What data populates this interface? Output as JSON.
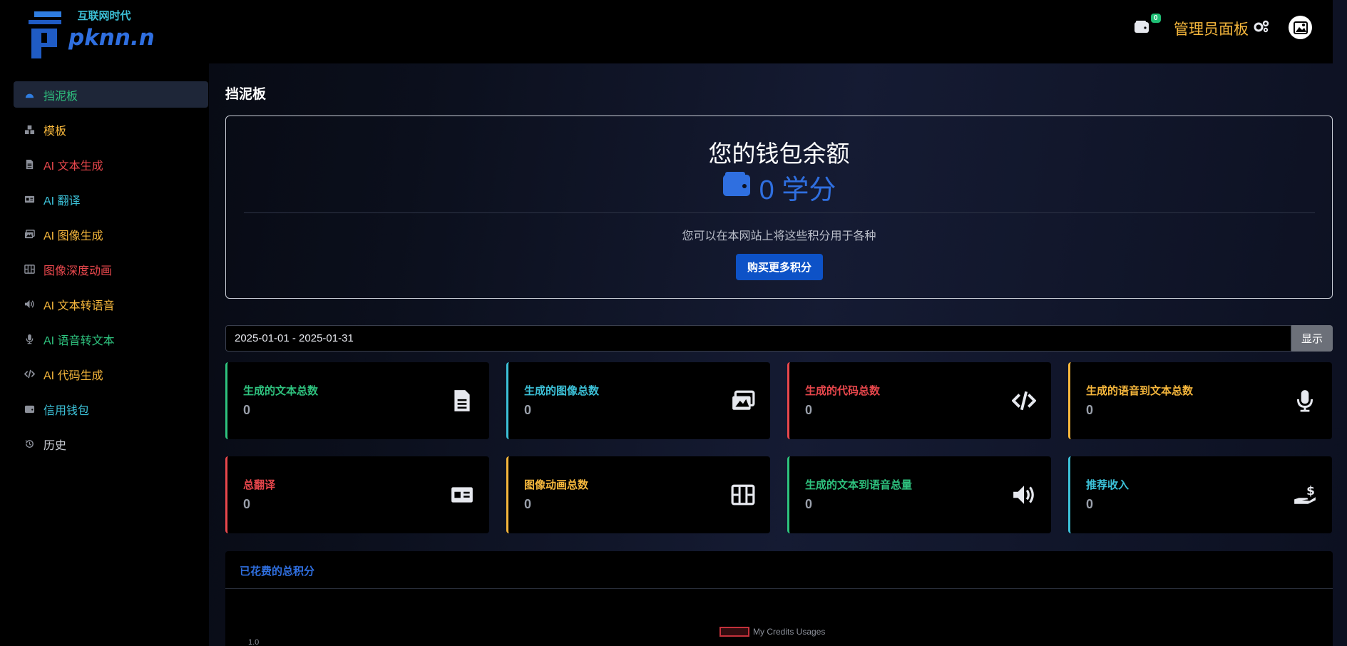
{
  "logo": {
    "brand": "pknn.net",
    "tagline": "互联网时代"
  },
  "topbar": {
    "wallet_count": "0",
    "admin_label": "管理员面板"
  },
  "sidebar": {
    "items": [
      {
        "label": "挡泥板",
        "icon": "dashboard-icon",
        "color": "#2ec27e",
        "active": true
      },
      {
        "label": "模板",
        "icon": "templates-icon",
        "color": "#f6b73c"
      },
      {
        "label": "AI 文本生成",
        "icon": "document-icon",
        "color": "#e8474c"
      },
      {
        "label": "AI 翻译",
        "icon": "translate-icon",
        "color": "#3cc1d8"
      },
      {
        "label": "AI 图像生成",
        "icon": "image-icon",
        "color": "#f6b73c"
      },
      {
        "label": "图像深度动画",
        "icon": "film-icon",
        "color": "#e8474c"
      },
      {
        "label": "AI 文本转语音",
        "icon": "speaker-icon",
        "color": "#f6b73c"
      },
      {
        "label": "AI 语音转文本",
        "icon": "microphone-icon",
        "color": "#2ec27e"
      },
      {
        "label": "AI 代码生成",
        "icon": "code-icon",
        "color": "#f6b73c"
      },
      {
        "label": "信用钱包",
        "icon": "wallet-icon",
        "color": "#3cc1d8"
      },
      {
        "label": "历史",
        "icon": "history-icon",
        "color": "#c9ccd3"
      }
    ]
  },
  "main": {
    "page_title": "挡泥板",
    "wallet": {
      "heading": "您的钱包余额",
      "amount": "0 学分",
      "description": "您可以在本网站上将这些积分用于各种",
      "buy_label": "购买更多积分"
    },
    "date_range": {
      "value": "2025-01-01 - 2025-01-31",
      "show_label": "显示"
    },
    "stats": [
      {
        "label": "生成的文本总数",
        "value": "0",
        "color": "#2ec27e",
        "icon": "document-icon"
      },
      {
        "label": "生成的图像总数",
        "value": "0",
        "color": "#3cc1d8",
        "icon": "images-icon"
      },
      {
        "label": "生成的代码总数",
        "value": "0",
        "color": "#e8474c",
        "icon": "code-icon"
      },
      {
        "label": "生成的语音到文本总数",
        "value": "0",
        "color": "#f6b73c",
        "icon": "microphone-icon"
      },
      {
        "label": "总翻译",
        "value": "0",
        "color": "#e8474c",
        "icon": "translate-icon"
      },
      {
        "label": "图像动画总数",
        "value": "0",
        "color": "#f6b73c",
        "icon": "film-icon"
      },
      {
        "label": "生成的文本到语音总量",
        "value": "0",
        "color": "#2ec27e",
        "icon": "speaker-icon"
      },
      {
        "label": "推荐收入",
        "value": "0",
        "color": "#3cc1d8",
        "icon": "hand-dollar-icon"
      }
    ],
    "chart": {
      "title": "已花费的总积分",
      "legend": "My Credits Usages",
      "ytick": "1.0"
    }
  }
}
